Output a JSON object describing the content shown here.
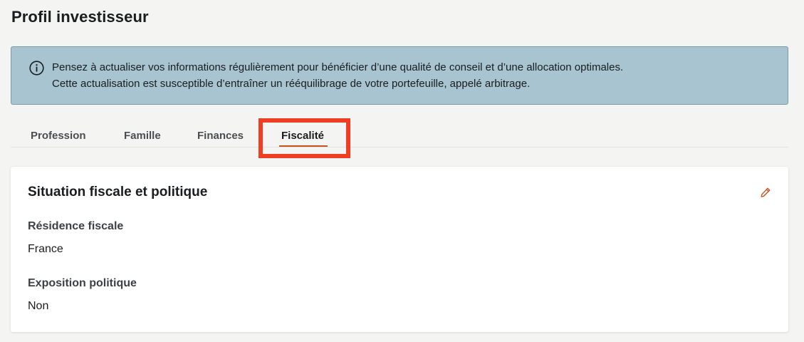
{
  "page": {
    "title": "Profil investisseur"
  },
  "info_banner": {
    "icon": "info-icon",
    "line1": "Pensez à actualiser vos informations régulièrement pour bénéficier d’une qualité de conseil et d’une allocation optimales.",
    "line2": "Cette actualisation est susceptible d’entraîner un rééquilibrage de votre portefeuille, appelé arbitrage."
  },
  "tabs": {
    "items": [
      {
        "label": "Profession"
      },
      {
        "label": "Famille"
      },
      {
        "label": "Finances"
      },
      {
        "label": "Fiscalité",
        "active": true
      }
    ]
  },
  "card": {
    "title": "Situation fiscale et politique",
    "edit_icon": "pencil-icon",
    "fields": [
      {
        "label": "Résidence fiscale",
        "value": "France"
      },
      {
        "label": "Exposition politique",
        "value": "Non"
      }
    ]
  },
  "colors": {
    "banner_bg": "#a7c4d0",
    "accent": "#c9531f",
    "highlight": "#ef3e23"
  }
}
